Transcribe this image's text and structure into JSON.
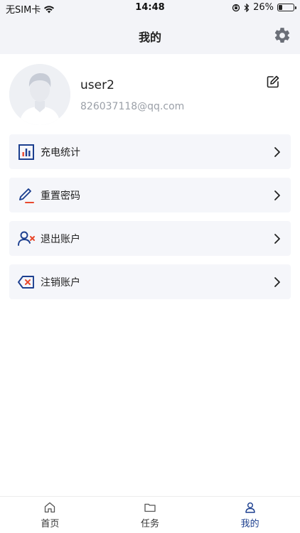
{
  "status_bar": {
    "carrier": "无SIM卡",
    "time": "14:48",
    "battery_percent": "26%",
    "battery_level": 0.26
  },
  "nav": {
    "title": "我的",
    "settings_icon": "gear-icon"
  },
  "profile": {
    "username": "user2",
    "email": "826037118@qq.com",
    "edit_icon": "edit-icon"
  },
  "menu": {
    "items": [
      {
        "label": "充电统计",
        "icon": "bar-chart-icon"
      },
      {
        "label": "重置密码",
        "icon": "pen-icon"
      },
      {
        "label": "退出账户",
        "icon": "user-remove-icon"
      },
      {
        "label": "注销账户",
        "icon": "delete-key-icon"
      }
    ]
  },
  "tabs": [
    {
      "label": "首页",
      "icon": "home-icon",
      "active": false
    },
    {
      "label": "任务",
      "icon": "folder-icon",
      "active": false
    },
    {
      "label": "我的",
      "icon": "user-icon",
      "active": true
    }
  ],
  "colors": {
    "accent": "#1c3f8f",
    "danger": "#e8492e",
    "header_bg": "#f3f4f8",
    "card_bg": "#f5f6fa"
  }
}
